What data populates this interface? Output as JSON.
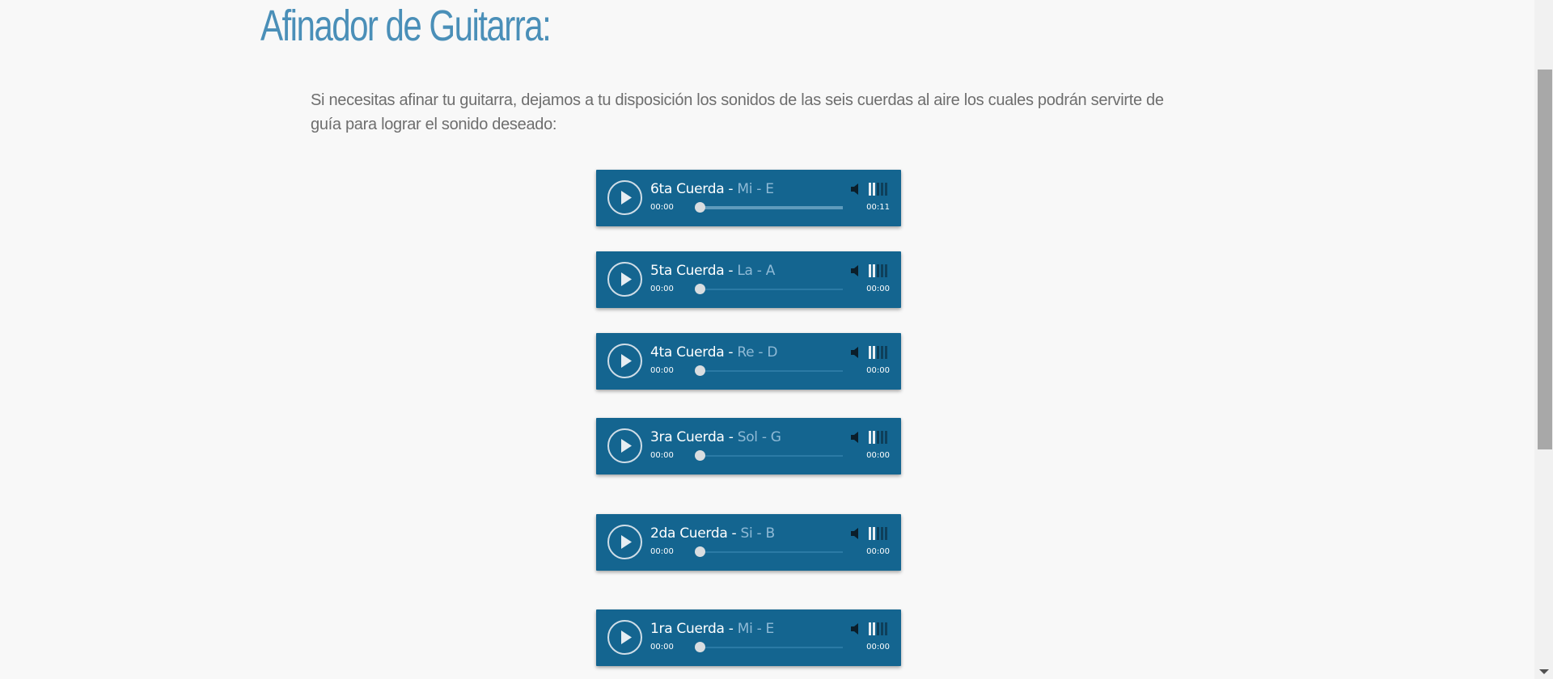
{
  "page": {
    "title": "Afinador de Guitarra:",
    "intro": "Si necesitas afinar tu guitarra, dejamos a tu disposición los sonidos de las seis cuerdas al aire los cuales podrán servirte de guía para lograr el sonido deseado:"
  },
  "colors": {
    "accent_title": "#4a8fb8",
    "player_bg": "#146590",
    "note_text": "#8fbad6"
  },
  "players": [
    {
      "name": "6ta Cuerda",
      "separator": "-",
      "note": "Mi - E",
      "current": "00:00",
      "total": "00:11",
      "loaded": true,
      "volume_bars_on": 2,
      "volume_bars_total": 5,
      "play_icon": "play-icon",
      "volume_icon": "speaker-icon"
    },
    {
      "name": "5ta Cuerda",
      "separator": "-",
      "note": "La - A",
      "current": "00:00",
      "total": "00:00",
      "loaded": false,
      "volume_bars_on": 2,
      "volume_bars_total": 5,
      "play_icon": "play-icon",
      "volume_icon": "speaker-icon"
    },
    {
      "name": "4ta Cuerda",
      "separator": "-",
      "note": "Re - D",
      "current": "00:00",
      "total": "00:00",
      "loaded": false,
      "volume_bars_on": 2,
      "volume_bars_total": 5,
      "play_icon": "play-icon",
      "volume_icon": "speaker-icon"
    },
    {
      "name": "3ra Cuerda",
      "separator": "-",
      "note": "Sol - G",
      "current": "00:00",
      "total": "00:00",
      "loaded": false,
      "volume_bars_on": 2,
      "volume_bars_total": 5,
      "play_icon": "play-icon",
      "volume_icon": "speaker-icon"
    },
    {
      "name": "2da Cuerda",
      "separator": "-",
      "note": "Si - B",
      "current": "00:00",
      "total": "00:00",
      "loaded": false,
      "volume_bars_on": 2,
      "volume_bars_total": 5,
      "play_icon": "play-icon",
      "volume_icon": "speaker-icon"
    },
    {
      "name": "1ra Cuerda",
      "separator": "-",
      "note": "Mi - E",
      "current": "00:00",
      "total": "00:00",
      "loaded": false,
      "volume_bars_on": 2,
      "volume_bars_total": 5,
      "play_icon": "play-icon",
      "volume_icon": "speaker-icon"
    }
  ]
}
